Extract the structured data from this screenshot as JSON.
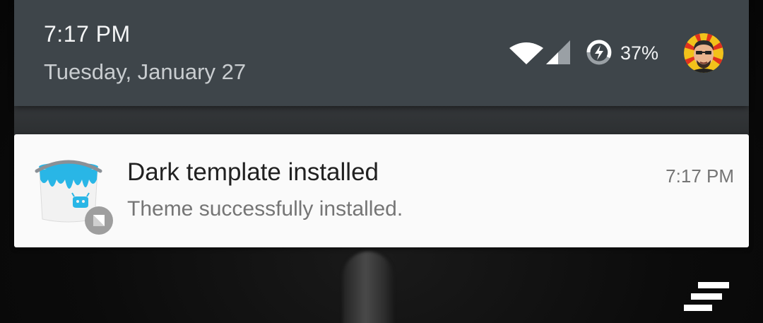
{
  "header": {
    "clock": "7:17 PM",
    "date": "Tuesday, January 27",
    "battery_percent": "37%",
    "battery_level": 0.37,
    "icons": [
      "wifi-icon",
      "cell-signal-icon",
      "battery-charging-icon",
      "user-avatar"
    ]
  },
  "notification": {
    "title": "Dark template installed",
    "text": "Theme successfully installed.",
    "time": "7:17 PM",
    "icon": "theme-paint-bucket-icon",
    "badge_icon": "small-notification-badge-icon"
  },
  "colors": {
    "header_bg": "#3e454a",
    "card_bg": "#fafafa",
    "accent": "#29b6e6"
  }
}
